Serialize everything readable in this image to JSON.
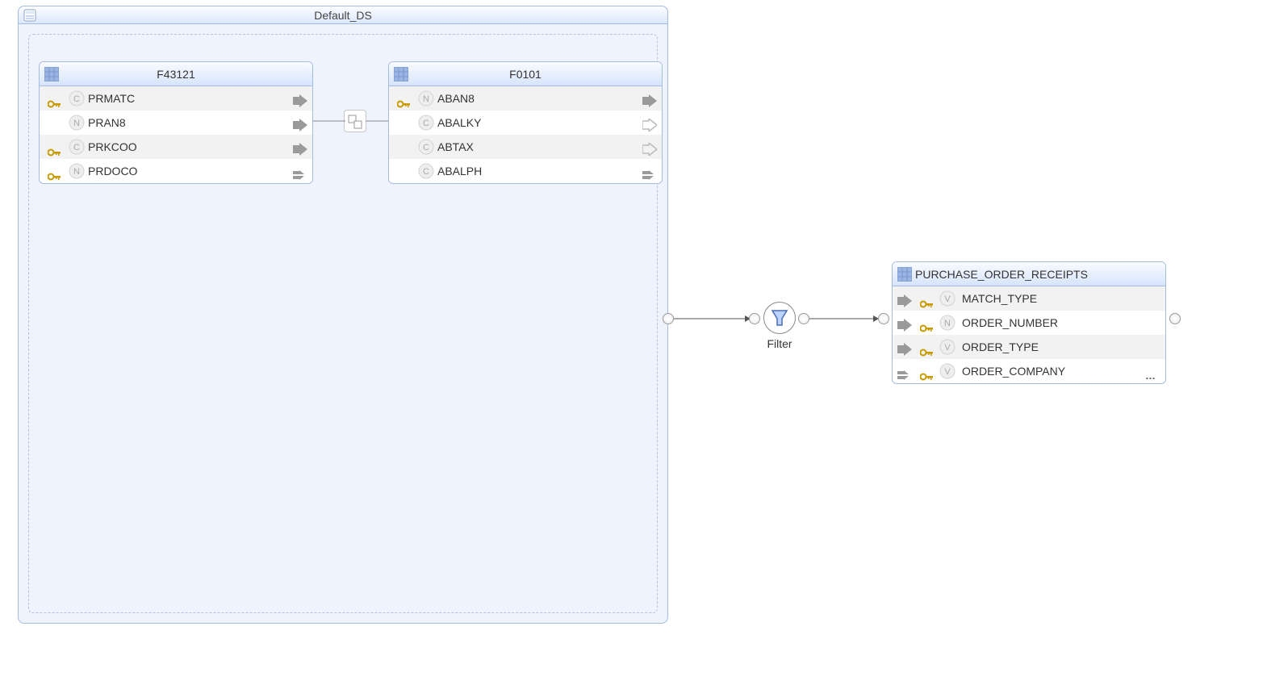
{
  "ds": {
    "title": "Default_DS"
  },
  "t1": {
    "title": "F43121",
    "rows": [
      {
        "name": "PRMATC",
        "key": true,
        "type": "C",
        "arrow": "solid",
        "odd": true
      },
      {
        "name": "PRAN8",
        "key": false,
        "type": "n",
        "arrow": "solid",
        "odd": false
      },
      {
        "name": "PRKCOO",
        "key": true,
        "type": "C",
        "arrow": "solid",
        "odd": true
      },
      {
        "name": "PRDOCO",
        "key": true,
        "type": "n",
        "arrow": "cut",
        "odd": false
      }
    ]
  },
  "t2": {
    "title": "F0101",
    "rows": [
      {
        "name": "ABAN8",
        "key": true,
        "type": "n",
        "arrow": "solid",
        "odd": true
      },
      {
        "name": "ABALKY",
        "key": false,
        "type": "C",
        "arrow": "hollow",
        "odd": false
      },
      {
        "name": "ABTAX",
        "key": false,
        "type": "C",
        "arrow": "hollow",
        "odd": true
      },
      {
        "name": "ABALPH",
        "key": false,
        "type": "C",
        "arrow": "cut",
        "odd": false
      }
    ]
  },
  "filter": {
    "label": "Filter"
  },
  "target": {
    "title": "PURCHASE_ORDER_RECEIPTS",
    "rows": [
      {
        "name": "MATCH_TYPE",
        "key": true,
        "type": "V",
        "odd": true,
        "cut": false
      },
      {
        "name": "ORDER_NUMBER",
        "key": true,
        "type": "n",
        "odd": false,
        "cut": false
      },
      {
        "name": "ORDER_TYPE",
        "key": true,
        "type": "V",
        "odd": true,
        "cut": false
      },
      {
        "name": "ORDER_COMPANY",
        "key": true,
        "type": "V",
        "odd": false,
        "cut": true
      }
    ],
    "more": "…"
  }
}
